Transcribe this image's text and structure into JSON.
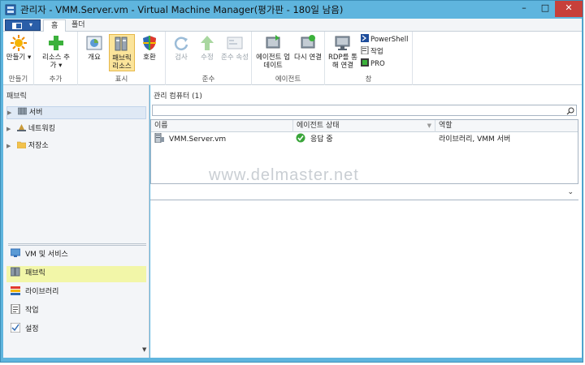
{
  "window": {
    "title": "관리자 - VMM.Server.vm - Virtual Machine Manager(평가판 - 180일 남음)",
    "minimize": "–",
    "maximize": "□",
    "close": "✕"
  },
  "ribbon": {
    "tabs": [
      "홈",
      "폴더"
    ],
    "groups": [
      {
        "label": "만들기",
        "buttons": [
          {
            "label": "만들기 ▾",
            "icon": "sparkle-create-icon"
          }
        ]
      },
      {
        "label": "추가",
        "buttons": [
          {
            "label": "리소스 추가 ▾",
            "icon": "green-plus-icon"
          }
        ]
      },
      {
        "label": "표시",
        "buttons": [
          {
            "label": "개요",
            "icon": "pie-chart-icon"
          },
          {
            "label": "패브릭 리소스",
            "icon": "fabric-resources-icon",
            "selected": true
          },
          {
            "label": "호환",
            "icon": "shield-icon"
          }
        ]
      },
      {
        "label": "준수",
        "buttons": [
          {
            "label": "검사",
            "icon": "refresh-scan-icon",
            "disabled": true
          },
          {
            "label": "수정",
            "icon": "up-arrow-icon",
            "disabled": true
          },
          {
            "label": "준수 속성",
            "icon": "properties-icon",
            "disabled": true
          }
        ]
      },
      {
        "label": "에이전트",
        "buttons": [
          {
            "label": "에이전트 업데이트",
            "icon": "agent-update-icon"
          },
          {
            "label": "다시 연결",
            "icon": "reconnect-icon"
          }
        ]
      },
      {
        "label": "창",
        "buttons": [
          {
            "label": "RDP를 통해 연결",
            "icon": "rdp-icon"
          }
        ],
        "small": [
          {
            "label": "PowerShell",
            "icon": "powershell-icon"
          },
          {
            "label": "작업",
            "icon": "jobs-icon"
          },
          {
            "label": "PRO",
            "icon": "pro-icon"
          }
        ]
      }
    ]
  },
  "left_pane": {
    "header": "패브릭",
    "tree": [
      {
        "label": "서버",
        "icon": "servers-icon",
        "selected": true
      },
      {
        "label": "네트워킹",
        "icon": "networking-icon"
      },
      {
        "label": "저장소",
        "icon": "storage-folder-icon"
      }
    ],
    "nav": [
      {
        "label": "VM 및 서비스",
        "icon": "vm-services-icon"
      },
      {
        "label": "패브릭",
        "icon": "fabric-icon",
        "selected": true
      },
      {
        "label": "라이브러리",
        "icon": "library-icon"
      },
      {
        "label": "작업",
        "icon": "jobs-icon"
      },
      {
        "label": "설정",
        "icon": "settings-icon"
      }
    ]
  },
  "main": {
    "header": "관리 컴퓨터 (1)",
    "search": {
      "value": "",
      "placeholder": ""
    },
    "columns": [
      "이름",
      "에이전트 상태",
      "역할"
    ],
    "rows": [
      {
        "name": "VMM.Server.vm",
        "status": "응답 중",
        "role": "라이브러리, VMM 서버"
      }
    ],
    "watermark": "www.delmaster.net"
  },
  "colors": {
    "titlebar": "#5fb5de",
    "close_button": "#c7403a",
    "selected_nav": "#eff578",
    "ribbon_selected": "#fbe49a",
    "status_ok": "#3aa53a"
  }
}
